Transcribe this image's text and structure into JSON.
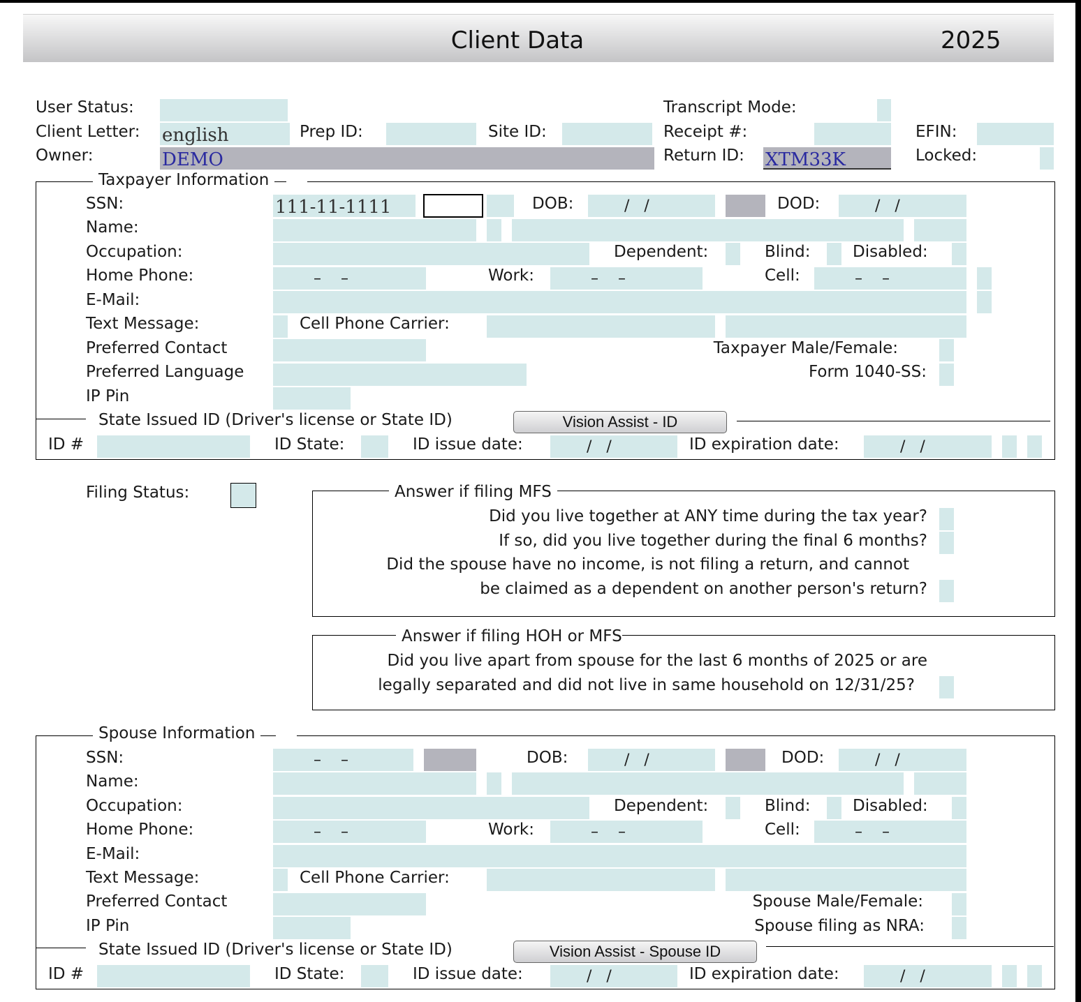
{
  "header": {
    "title": "Client Data",
    "year": "2025"
  },
  "top": {
    "user_status_label": "User Status:",
    "client_letter_label": "Client Letter:",
    "client_letter_value": "english",
    "owner_label": "Owner:",
    "owner_value": "DEMO",
    "prep_id_label": "Prep ID:",
    "site_id_label": "Site ID:",
    "transcript_mode_label": "Transcript Mode:",
    "receipt_label": "Receipt #:",
    "return_id_label": "Return ID:",
    "return_id_value": "XTM33K",
    "efin_label": "EFIN:",
    "locked_label": "Locked:"
  },
  "masks": {
    "date": "  /   /",
    "phone": "–    –",
    "ssn_blank": "–    –"
  },
  "taxpayer": {
    "legend": "Taxpayer Information",
    "ssn_label": "SSN:",
    "ssn_value": "111-11-1111",
    "dob_label": "DOB:",
    "dod_label": "DOD:",
    "name_label": "Name:",
    "occupation_label": "Occupation:",
    "dependent_label": "Dependent:",
    "blind_label": "Blind:",
    "disabled_label": "Disabled:",
    "home_phone_label": "Home Phone:",
    "work_label": "Work:",
    "cell_label": "Cell:",
    "email_label": "E-Mail:",
    "text_message_label": "Text Message:",
    "cell_carrier_label": "Cell Phone Carrier:",
    "preferred_contact_label": "Preferred Contact",
    "preferred_language_label": "Preferred Language",
    "ip_pin_label": "IP Pin",
    "gender_label": "Taxpayer Male/Female:",
    "form_1040ss_label": "Form 1040-SS:"
  },
  "taxpayer_id": {
    "legend": "State Issued ID (Driver's license or State ID)",
    "button": "Vision Assist - ID",
    "id_label": "ID #",
    "state_label": "ID State:",
    "issue_label": "ID issue date:",
    "expiration_label": "ID expiration date:"
  },
  "filing": {
    "label": "Filing Status:",
    "mfs_legend": "Answer if filing MFS",
    "mfs_q1": "Did you live together at ANY time during the tax year?",
    "mfs_q2": "If so, did you live together during the final 6 months?",
    "mfs_q3_line1": "Did the spouse have no income, is not filing a return, and cannot",
    "mfs_q3_line2": "be claimed as a dependent on another person's return?",
    "hoh_legend": "Answer if filing HOH or MFS",
    "hoh_q_line1": "Did you live apart from spouse for the last 6 months of 2025 or are",
    "hoh_q_line2": "legally separated and did not live in same household on 12/31/25?"
  },
  "spouse": {
    "legend": "Spouse Information",
    "ssn_label": "SSN:",
    "dob_label": "DOB:",
    "dod_label": "DOD:",
    "name_label": "Name:",
    "occupation_label": "Occupation:",
    "dependent_label": "Dependent:",
    "blind_label": "Blind:",
    "disabled_label": "Disabled:",
    "home_phone_label": "Home Phone:",
    "work_label": "Work:",
    "cell_label": "Cell:",
    "email_label": "E-Mail:",
    "text_message_label": "Text Message:",
    "cell_carrier_label": "Cell Phone Carrier:",
    "preferred_contact_label": "Preferred Contact",
    "ip_pin_label": "IP Pin",
    "gender_label": "Spouse Male/Female:",
    "nra_label": "Spouse filing as NRA:"
  },
  "spouse_id": {
    "legend": "State Issued ID (Driver's license or State ID)",
    "button": "Vision Assist - Spouse ID",
    "id_label": "ID #",
    "state_label": "ID State:",
    "issue_label": "ID issue date:",
    "expiration_label": "ID expiration date:"
  },
  "colors": {
    "field": "#d4e9ea",
    "field_readonly": "#b4b4bc",
    "value_blue": "#2a2aa0"
  }
}
